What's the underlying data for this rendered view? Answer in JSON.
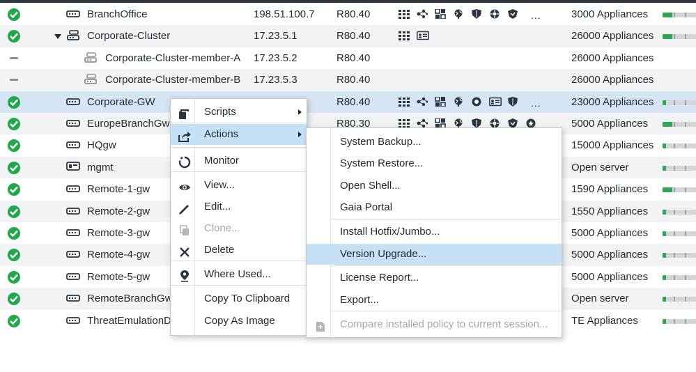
{
  "rows": [
    {
      "status": "ok",
      "name": "BranchOffice",
      "version": "198.51.100.7",
      "ver": "R80.40",
      "hw": "3000 Appliances",
      "indent": 0,
      "toggle": false,
      "blades": 7,
      "more": "...",
      "meter": 30,
      "alt": false
    },
    {
      "status": "ok",
      "name": "Corporate-Cluster",
      "version": "17.23.5.1",
      "ver": "R80.40",
      "hw": "26000 Appliances",
      "indent": 0,
      "toggle": true,
      "blades": 2,
      "more": "",
      "meter": 30,
      "alt": true
    },
    {
      "status": "dash",
      "name": "Corporate-Cluster-member-A",
      "version": "17.23.5.2",
      "ver": "R80.40",
      "hw": "26000 Appliances",
      "indent": 1,
      "toggle": false,
      "blades": 0,
      "more": "",
      "meter": null,
      "alt": false
    },
    {
      "status": "dash",
      "name": "Corporate-Cluster-member-B",
      "version": "17.23.5.3",
      "ver": "R80.40",
      "hw": "26000 Appliances",
      "indent": 1,
      "toggle": false,
      "blades": 0,
      "more": "",
      "meter": null,
      "alt": true
    },
    {
      "status": "ok",
      "name": "Corporate-GW",
      "version": "",
      "ver": "R80.40",
      "hw": "23000 Appliances",
      "indent": 0,
      "toggle": false,
      "blades": 7,
      "more": "...",
      "meter": 10,
      "alt": false,
      "sel": true
    },
    {
      "status": "ok",
      "name": "EuropeBranchGw",
      "version": "",
      "ver": "R80.30",
      "hw": "5000 Appliances",
      "indent": 0,
      "toggle": false,
      "blades": 8,
      "more": "",
      "meter": 30,
      "alt": true
    },
    {
      "status": "ok",
      "name": "HQgw",
      "version": "",
      "ver": "",
      "hw": "15000 Appliances",
      "indent": 0,
      "toggle": false,
      "blades": 0,
      "more": "",
      "meter": 10,
      "alt": false
    },
    {
      "status": "ok",
      "name": "mgmt",
      "version": "",
      "ver": "",
      "hw": "Open server",
      "indent": 0,
      "toggle": false,
      "blades": 0,
      "more": "",
      "meter": 10,
      "alt": true
    },
    {
      "status": "ok",
      "name": "Remote-1-gw",
      "version": "",
      "ver": "",
      "hw": "1590 Appliances",
      "indent": 0,
      "toggle": false,
      "blades": 0,
      "more": "",
      "meter": 30,
      "alt": false
    },
    {
      "status": "ok",
      "name": "Remote-2-gw",
      "version": "",
      "ver": "",
      "hw": "1550 Appliances",
      "indent": 0,
      "toggle": false,
      "blades": 0,
      "more": "",
      "meter": 10,
      "alt": true
    },
    {
      "status": "ok",
      "name": "Remote-3-gw",
      "version": "",
      "ver": "",
      "hw": "5000 Appliances",
      "indent": 0,
      "toggle": false,
      "blades": 0,
      "more": "",
      "meter": 10,
      "alt": false
    },
    {
      "status": "ok",
      "name": "Remote-4-gw",
      "version": "",
      "ver": "",
      "hw": "5000 Appliances",
      "indent": 0,
      "toggle": false,
      "blades": 0,
      "more": "",
      "meter": 10,
      "alt": true
    },
    {
      "status": "ok",
      "name": "Remote-5-gw",
      "version": "",
      "ver": "",
      "hw": "5000 Appliances",
      "indent": 0,
      "toggle": false,
      "blades": 0,
      "more": "",
      "meter": 10,
      "alt": false
    },
    {
      "status": "ok",
      "name": "RemoteBranchGw",
      "version": "",
      "ver": "",
      "hw": "Open server",
      "indent": 0,
      "toggle": false,
      "blades": 0,
      "more": "",
      "meter": 10,
      "alt": true
    },
    {
      "status": "ok",
      "name": "ThreatEmulationD",
      "version": "",
      "ver": "",
      "hw": "TE Appliances",
      "indent": 0,
      "toggle": false,
      "blades": 0,
      "more": "",
      "meter": 10,
      "alt": false
    }
  ],
  "context_menu": {
    "items": [
      {
        "label": "Scripts",
        "icon": "script-icon",
        "submenu": true,
        "disabled": false,
        "highlight": false
      },
      {
        "label": "Actions",
        "icon": "actions-icon",
        "submenu": true,
        "disabled": false,
        "highlight": true
      },
      {
        "label": "Monitor",
        "icon": "monitor-icon",
        "submenu": false,
        "disabled": false,
        "highlight": false
      },
      {
        "label": "View...",
        "icon": "eye-icon",
        "submenu": false,
        "disabled": false,
        "highlight": false
      },
      {
        "label": "Edit...",
        "icon": "pencil-icon",
        "submenu": false,
        "disabled": false,
        "highlight": false
      },
      {
        "label": "Clone...",
        "icon": "clone-icon",
        "submenu": false,
        "disabled": true,
        "highlight": false
      },
      {
        "label": "Delete",
        "icon": "delete-icon",
        "submenu": false,
        "disabled": false,
        "highlight": false
      },
      {
        "label": "Where Used...",
        "icon": "location-pin-icon",
        "submenu": false,
        "disabled": false,
        "highlight": false
      },
      {
        "label": "Copy To Clipboard",
        "icon": "",
        "submenu": false,
        "disabled": false,
        "highlight": false
      },
      {
        "label": "Copy As Image",
        "icon": "",
        "submenu": false,
        "disabled": false,
        "highlight": false
      }
    ]
  },
  "actions_submenu": {
    "items": [
      {
        "label": "System Backup...",
        "disabled": false,
        "highlight": false
      },
      {
        "label": "System Restore...",
        "disabled": false,
        "highlight": false
      },
      {
        "label": "Open Shell...",
        "disabled": false,
        "highlight": false
      },
      {
        "label": "Gaia Portal",
        "disabled": false,
        "highlight": false
      },
      {
        "label": "Install Hotfix/Jumbo...",
        "disabled": false,
        "highlight": false
      },
      {
        "label": "Version Upgrade...",
        "disabled": false,
        "highlight": true
      },
      {
        "label": "License Report...",
        "disabled": false,
        "highlight": false
      },
      {
        "label": "Export...",
        "disabled": false,
        "highlight": false
      },
      {
        "label": "Compare installed policy to current session...",
        "disabled": true,
        "highlight": false
      }
    ]
  },
  "colors": {
    "status_ok": "#22a84a",
    "selection": "#d6e5f4",
    "menu_highlight": "#c6e0f6",
    "annotation": "#f3f53a"
  }
}
